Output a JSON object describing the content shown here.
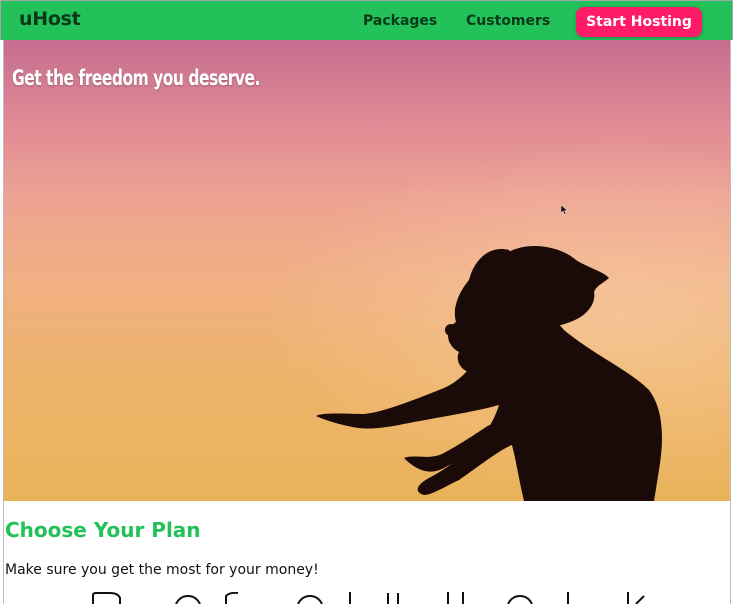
{
  "header": {
    "brand": "uHost",
    "nav": {
      "packages": "Packages",
      "customers": "Customers"
    },
    "cta_label": "Start Hosting"
  },
  "hero": {
    "title": "Get the freedom you deserve."
  },
  "plans": {
    "title": "Choose Your Plan",
    "subtitle": "Make sure you get the most for your money!"
  },
  "colors": {
    "header_bg": "#22c15a",
    "brand_text": "#0a3818",
    "cta_bg": "#ff1b68",
    "cta_text": "#ffffff",
    "section_title": "#22c15a"
  },
  "icons": {
    "cursor": "mouse-cursor-icon"
  }
}
